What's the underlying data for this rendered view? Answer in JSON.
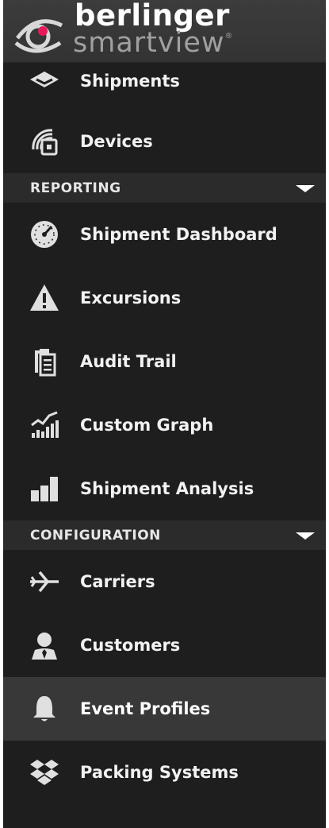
{
  "brand": {
    "name": "berlinger",
    "product": "smartview",
    "registered_mark": "®",
    "accent_color": "#e8195a"
  },
  "menu": {
    "partial_item": {
      "label": "Shipments",
      "icon": "shipments-icon"
    },
    "items_top": [
      {
        "label": "Devices",
        "icon": "devices-icon"
      }
    ],
    "reporting": {
      "label": "REPORTING",
      "items": [
        {
          "label": "Shipment Dashboard",
          "icon": "dashboard-gauge-icon"
        },
        {
          "label": "Excursions",
          "icon": "warning-icon"
        },
        {
          "label": "Audit Trail",
          "icon": "clipboard-icon"
        },
        {
          "label": "Custom Graph",
          "icon": "line-graph-icon"
        },
        {
          "label": "Shipment Analysis",
          "icon": "bar-chart-icon"
        }
      ]
    },
    "configuration": {
      "label": "CONFIGURATION",
      "items": [
        {
          "label": "Carriers",
          "icon": "airplane-icon"
        },
        {
          "label": "Customers",
          "icon": "user-icon"
        },
        {
          "label": "Event Profiles",
          "icon": "bell-icon",
          "active": true
        },
        {
          "label": "Packing Systems",
          "icon": "dropbox-icon"
        }
      ]
    }
  },
  "colors": {
    "sidebar_bg": "#1e1e1e",
    "section_bg": "#2b2b2b",
    "active_bg": "#383838",
    "text": "#f2f2f2"
  }
}
